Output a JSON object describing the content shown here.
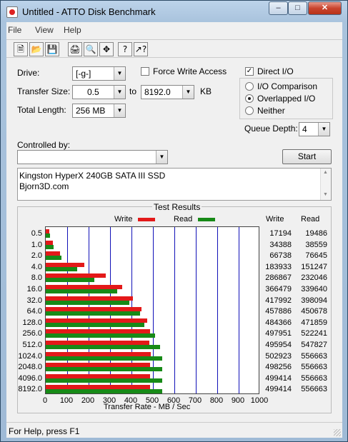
{
  "window": {
    "title": "Untitled - ATTO Disk Benchmark"
  },
  "menu": [
    "File",
    "View",
    "Help"
  ],
  "toolbar": {
    "buttons": [
      "new-icon",
      "open-icon",
      "save-icon",
      "print-icon",
      "print-preview-icon",
      "move-icon",
      "help-icon",
      "context-help-icon"
    ]
  },
  "form": {
    "drive_label": "Drive:",
    "drive_value": "[-g-]",
    "force_write_label": "Force Write Access",
    "force_write_checked": false,
    "direct_io_label": "Direct I/O",
    "direct_io_checked": true,
    "transfer_size_label": "Transfer Size:",
    "transfer_from": "0.5",
    "to_label": "to",
    "transfer_to": "8192.0",
    "kb_label": "KB",
    "total_length_label": "Total Length:",
    "total_length_value": "256 MB",
    "io_comparison_label": "I/O Comparison",
    "overlapped_io_label": "Overlapped I/O",
    "neither_label": "Neither",
    "io_mode_selected": "Overlapped I/O",
    "queue_depth_label": "Queue Depth:",
    "queue_depth_value": "4",
    "controlled_by_label": "Controlled by:",
    "controlled_by_value": "",
    "start_label": "Start"
  },
  "description": {
    "line1": "Kingston HyperX 240GB SATA III SSD",
    "line2": "Bjorn3D.com"
  },
  "results": {
    "caption": "Test Results",
    "legend_write": "Write",
    "legend_read": "Read",
    "col_write": "Write",
    "col_read": "Read",
    "xlabel": "Transfer Rate - MB / Sec",
    "xticks": [
      "0",
      "100",
      "200",
      "300",
      "400",
      "500",
      "600",
      "700",
      "800",
      "900",
      "1000"
    ],
    "write_color": "#e31919",
    "read_color": "#178a17"
  },
  "chart_data": {
    "type": "bar",
    "title": "Test Results",
    "xlabel": "Transfer Rate - MB / Sec",
    "xlim": [
      0,
      1000
    ],
    "categories": [
      "0.5",
      "1.0",
      "2.0",
      "4.0",
      "8.0",
      "16.0",
      "32.0",
      "64.0",
      "128.0",
      "256.0",
      "512.0",
      "1024.0",
      "2048.0",
      "4096.0",
      "8192.0"
    ],
    "series": [
      {
        "name": "Write",
        "values": [
          17194,
          34388,
          66738,
          183933,
          286867,
          366479,
          417992,
          457886,
          484366,
          497951,
          495954,
          502923,
          498256,
          499414,
          499414
        ]
      },
      {
        "name": "Read",
        "values": [
          19486,
          38559,
          76645,
          151247,
          232046,
          339640,
          398094,
          450678,
          471859,
          522241,
          547827,
          556663,
          556663,
          556663,
          556663
        ]
      }
    ]
  },
  "status": {
    "text": "For Help, press F1"
  }
}
